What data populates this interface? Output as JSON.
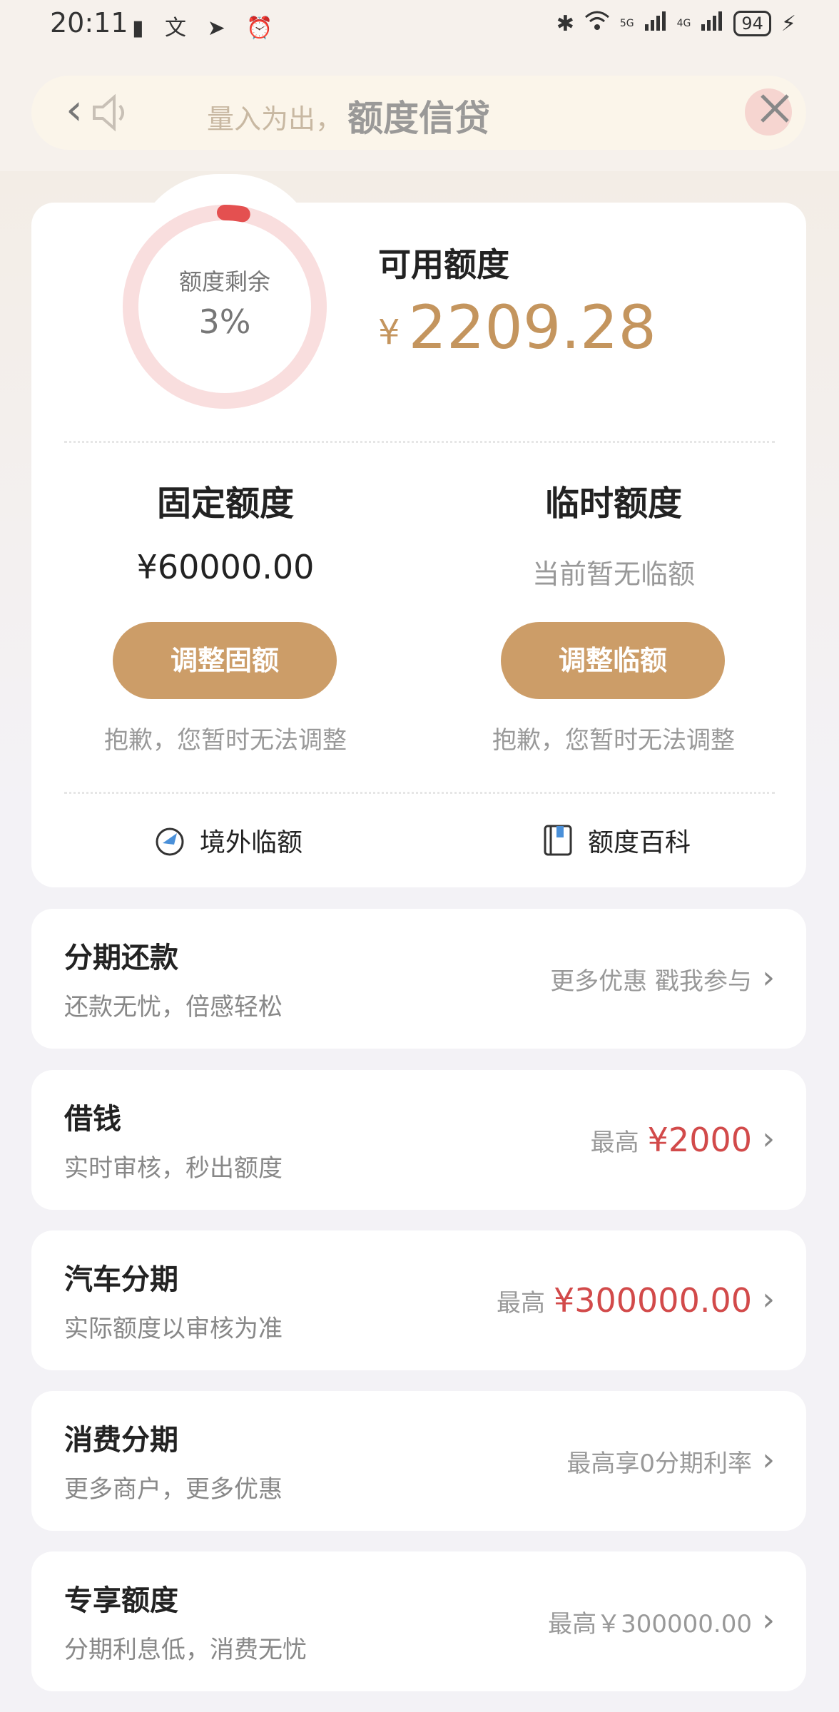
{
  "status_bar": {
    "time": "20:11",
    "left_icons": "▮ 文 ➤ ⏰",
    "bluetooth": "✱",
    "net_5g": "5G",
    "net_4g": "4G",
    "battery": "94"
  },
  "header": {
    "title": "额度信贷",
    "notice": "量入为出，",
    "back_icon": "‹"
  },
  "quota": {
    "ring_label": "额度剩余",
    "ring_percent": "3%",
    "remaining_fraction": 0.03,
    "available_label": "可用额度",
    "available_currency": "¥",
    "available_amount": "2209.28",
    "fixed": {
      "title": "固定额度",
      "value": "¥60000.00",
      "button": "调整固额",
      "note": "抱歉，您暂时无法调整"
    },
    "temporary": {
      "title": "临时额度",
      "value": "当前暂无临额",
      "button": "调整临额",
      "note": "抱歉，您暂时无法调整"
    },
    "links": {
      "overseas": "境外临额",
      "encyclopedia": "额度百科"
    }
  },
  "items": [
    {
      "title": "分期还款",
      "subtitle": "还款无忧，倍感轻松",
      "right_text": "更多优惠 戳我参与"
    },
    {
      "title": "借钱",
      "subtitle": "实时审核，秒出额度",
      "right_prefix": "最高",
      "right_amount": "¥2000"
    },
    {
      "title": "汽车分期",
      "subtitle": "实际额度以审核为准",
      "right_prefix": "最高",
      "right_amount": "¥300000.00"
    },
    {
      "title": "消费分期",
      "subtitle": "更多商户，更多优惠",
      "right_text": "最高享0分期利率"
    },
    {
      "title": "专享额度",
      "subtitle": "分期利息低，消费无忧",
      "right_text": "最高￥300000.00"
    }
  ],
  "colors": {
    "accent_gold": "#cc9d68",
    "amount_gold": "#c4955e",
    "ring_track": "#f9dede",
    "ring_fill": "#e45050",
    "highlight_red": "#d24a4a"
  }
}
